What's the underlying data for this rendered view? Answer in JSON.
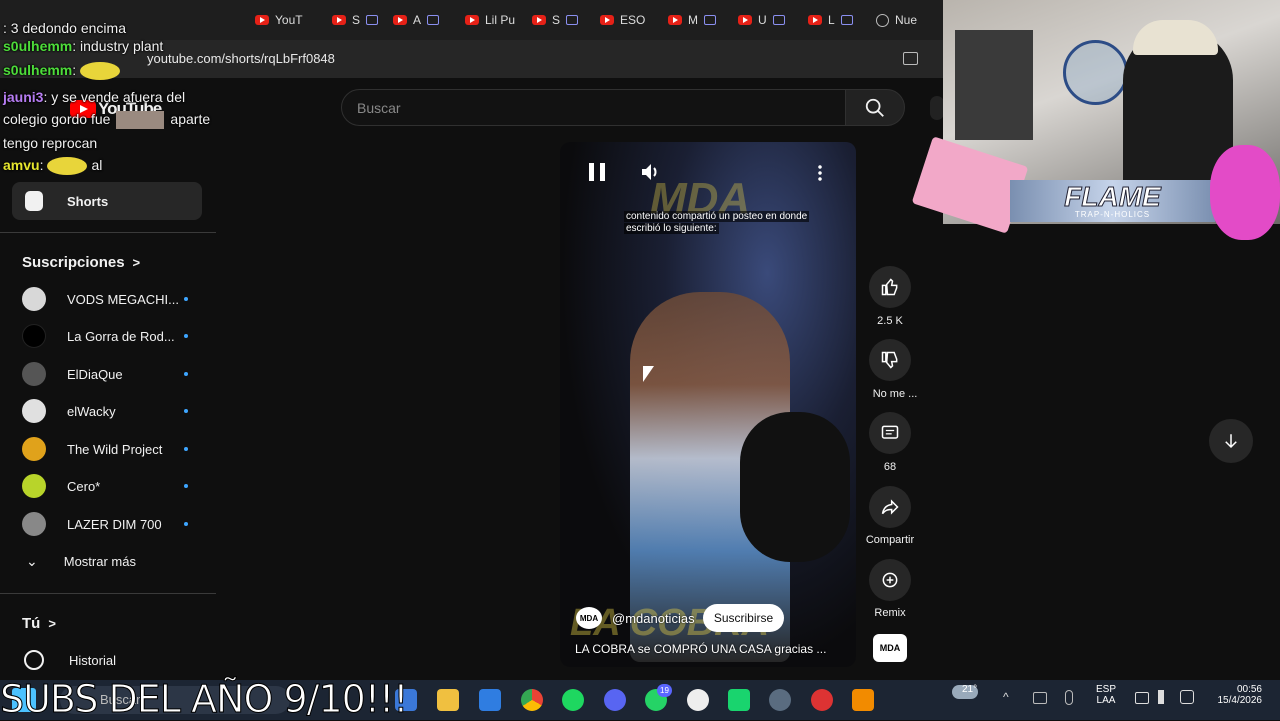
{
  "browser": {
    "tabs": [
      {
        "label": "YouT"
      },
      {
        "label": "S"
      },
      {
        "label": "A"
      },
      {
        "label": "Lil Pu"
      },
      {
        "label": "S"
      },
      {
        "label": "ESO"
      },
      {
        "label": "M"
      },
      {
        "label": "U"
      },
      {
        "label": "L"
      },
      {
        "label": "Nue"
      }
    ],
    "url": "youtube.com/shorts/rqLbFrf0848"
  },
  "chat": [
    {
      "user": "",
      "text": ": 3 dedondo encima",
      "color": "#e05555"
    },
    {
      "user": "s0ulhemm",
      "text": ": industry plant",
      "color": "#4ddc3a"
    },
    {
      "user": "s0ulhemm",
      "text": ":",
      "color": "#4ddc3a"
    },
    {
      "user": "jauni3",
      "text": ": y se vende afuera del",
      "color": "#b67cf2"
    },
    {
      "user": "",
      "text": "colegio gordo fue",
      "color": ""
    },
    {
      "user": "",
      "text": "aparte",
      "color": ""
    },
    {
      "user": "",
      "text": "tengo reprocan",
      "color": ""
    },
    {
      "user": "amvu",
      "text": ":",
      "color": "#e6e62e"
    },
    {
      "user": "",
      "text": "al",
      "color": ""
    }
  ],
  "youtube": {
    "logo": "YouTube",
    "search_placeholder": "Buscar",
    "sidebar": {
      "shorts": "Shorts",
      "subscriptions_header": "Suscripciones",
      "channels": [
        {
          "name": "VODS MEGACHI...",
          "avatar_color": "#d8d8d8"
        },
        {
          "name": "La Gorra de Rod...",
          "avatar_color": "#111111"
        },
        {
          "name": "ElDiaQue",
          "avatar_color": "#555555"
        },
        {
          "name": "elWacky",
          "avatar_color": "#e0e0e0"
        },
        {
          "name": "The Wild Project",
          "avatar_color": "#e0a21b"
        },
        {
          "name": "Cero*",
          "avatar_color": "#b8d42a"
        },
        {
          "name": "LAZER DIM 700",
          "avatar_color": "#888888"
        }
      ],
      "show_more": "Mostrar más",
      "you_header": "Tú",
      "history": "Historial"
    },
    "short": {
      "caption_line1": "contenido compartió un posteo en donde",
      "caption_line2": "escribió lo siguiente:",
      "watermark": "MDA",
      "channel_handle": "@mdanoticias",
      "subscribe_label": "Suscribirse",
      "title": "LA COBRA se COMPRÓ UNA CASA gracias ...",
      "bottom_watermark": "LA COBRA"
    },
    "actions": {
      "likes": "2.5 K",
      "dislike_label": "No me ...",
      "comments": "68",
      "share_label": "Compartir",
      "remix_label": "Remix"
    }
  },
  "webcam": {
    "banner_text": "FLAME",
    "banner_sub": "TRAP-N-HOLICS"
  },
  "taskbar": {
    "overlay_text": "SUBS DEL AÑO 9/10!!!",
    "search_label": "Buscar",
    "weather": "21°",
    "lang_line1": "ESP",
    "lang_line2": "LAA",
    "time": "00:56",
    "date": "15/4/2026",
    "whatsapp_badge": "19"
  }
}
